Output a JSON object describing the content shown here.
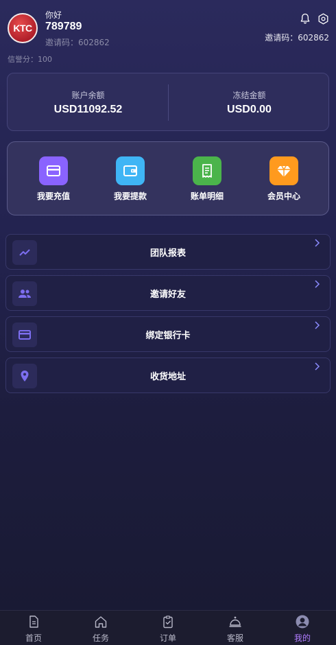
{
  "profile": {
    "logo_text": "KTC",
    "greeting": "你好",
    "username": "789789",
    "invite_code_left": "邀请码：602862",
    "credit_score": "信誉分：100",
    "invite_code_right": "邀请码：602862"
  },
  "balance": {
    "account_label": "账户余额",
    "account_value": "USD11092.52",
    "frozen_label": "冻结金额",
    "frozen_value": "USD0.00"
  },
  "actions": [
    {
      "label": "我要充值",
      "icon": "card-icon",
      "color": "#8a63ff"
    },
    {
      "label": "我要提款",
      "icon": "wallet-icon",
      "color": "#3fb5f5"
    },
    {
      "label": "账单明细",
      "icon": "receipt-icon",
      "color": "#4bb44b"
    },
    {
      "label": "会员中心",
      "icon": "diamond-icon",
      "color": "#ff9a1e"
    }
  ],
  "menu": [
    {
      "label": "团队报表",
      "icon": "chart-line-icon"
    },
    {
      "label": "邀请好友",
      "icon": "people-icon"
    },
    {
      "label": "绑定银行卡",
      "icon": "credit-card-icon"
    },
    {
      "label": "收货地址",
      "icon": "location-pin-icon"
    }
  ],
  "tabs": [
    {
      "label": "首页",
      "icon": "document-icon"
    },
    {
      "label": "任务",
      "icon": "home-icon"
    },
    {
      "label": "订单",
      "icon": "clipboard-icon"
    },
    {
      "label": "客服",
      "icon": "service-bell-icon"
    },
    {
      "label": "我的",
      "icon": "user-avatar-icon",
      "active": true
    }
  ],
  "colors": {
    "accent": "#b07cff",
    "background": "#232350",
    "card": "#2e2d5c"
  }
}
